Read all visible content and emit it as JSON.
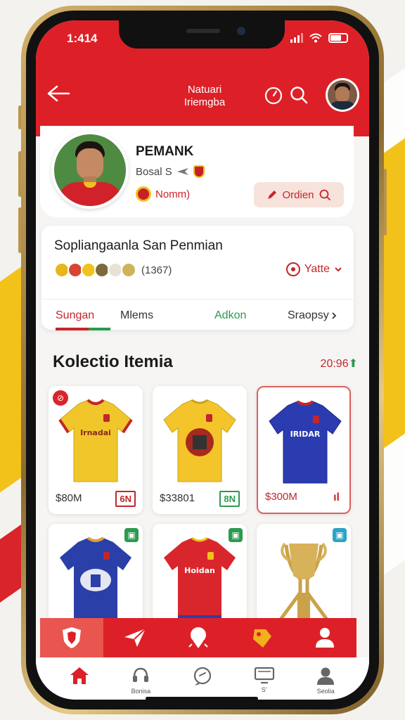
{
  "status": {
    "time": "1:414"
  },
  "header": {
    "title_line1": "Natuari",
    "title_line2": "Iriemgba"
  },
  "profile": {
    "name": "PEMANK",
    "subtitle": "Bosal S",
    "team": "Nomm)",
    "order_label": "Ordien"
  },
  "collection": {
    "title": "Sopliangaanla San Penmian",
    "count": "(1367)",
    "filter_label": "Yatte",
    "tabs": [
      "Sungan",
      "Mlems",
      "Adkon",
      "Sraopsy"
    ]
  },
  "section": {
    "title": "Kolectio Itemia",
    "rate": "20:96"
  },
  "products": [
    {
      "price": "$80M",
      "tag": "6N",
      "kind": "yellow",
      "text": "Irnadai"
    },
    {
      "price": "$33801",
      "tag": "8N",
      "kind": "yellow2",
      "text": ""
    },
    {
      "price": "$300M",
      "tag": "ıl",
      "kind": "blue",
      "text": "IRIDAR"
    },
    {
      "price": "",
      "tag": "",
      "kind": "blue2",
      "text": ""
    },
    {
      "price": "",
      "tag": "",
      "kind": "red",
      "text": "Hoidan"
    },
    {
      "price": "",
      "tag": "",
      "kind": "trophy",
      "text": ""
    }
  ],
  "bottom_nav": [
    {
      "label": "",
      "icon": "home-icon"
    },
    {
      "label": "Bonisa",
      "icon": "headset-icon"
    },
    {
      "label": "",
      "icon": "chat-icon"
    },
    {
      "label": "S'",
      "icon": "tv-icon"
    },
    {
      "label": "Seolia",
      "icon": "profile-icon"
    }
  ],
  "colors": {
    "brand_red": "#dd2027",
    "accent_yellow": "#f2c21b",
    "accent_green": "#2c9a4e"
  }
}
